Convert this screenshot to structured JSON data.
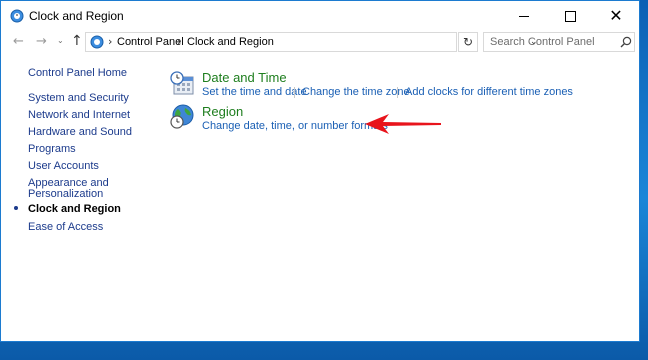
{
  "window": {
    "title": "Clock and Region",
    "controls": {
      "minimize": "–",
      "maximize": "□",
      "close": "✕"
    }
  },
  "nav": {
    "back_icon": "left-arrow-icon",
    "forward_icon": "right-arrow-icon",
    "up_icon": "up-arrow-icon",
    "breadcrumbs": [
      "Control Panel",
      "Clock and Region"
    ],
    "search_placeholder": "Search Control Panel"
  },
  "sidebar": {
    "items": [
      {
        "label": "Control Panel Home"
      },
      {
        "label": "System and Security"
      },
      {
        "label": "Network and Internet"
      },
      {
        "label": "Hardware and Sound"
      },
      {
        "label": "Programs"
      },
      {
        "label": "User Accounts"
      },
      {
        "label": "Appearance and"
      },
      {
        "label": "Personalization"
      },
      {
        "label": "Clock and Region",
        "current": true
      },
      {
        "label": "Ease of Access"
      }
    ]
  },
  "categories": [
    {
      "title": "Date and Time",
      "icon": "calendar-clock-icon",
      "links": [
        "Set the time and date",
        "Change the time zone",
        "Add clocks for different time zones"
      ]
    },
    {
      "title": "Region",
      "icon": "globe-clock-icon",
      "links": [
        "Change date, time, or number formats"
      ]
    }
  ],
  "annotation": {
    "icon": "red-arrow-icon",
    "color": "#e8141c"
  },
  "colors": {
    "link": "#1a5fb4",
    "category_title": "#1e7e1e",
    "desktop": "#0a6fc2"
  }
}
